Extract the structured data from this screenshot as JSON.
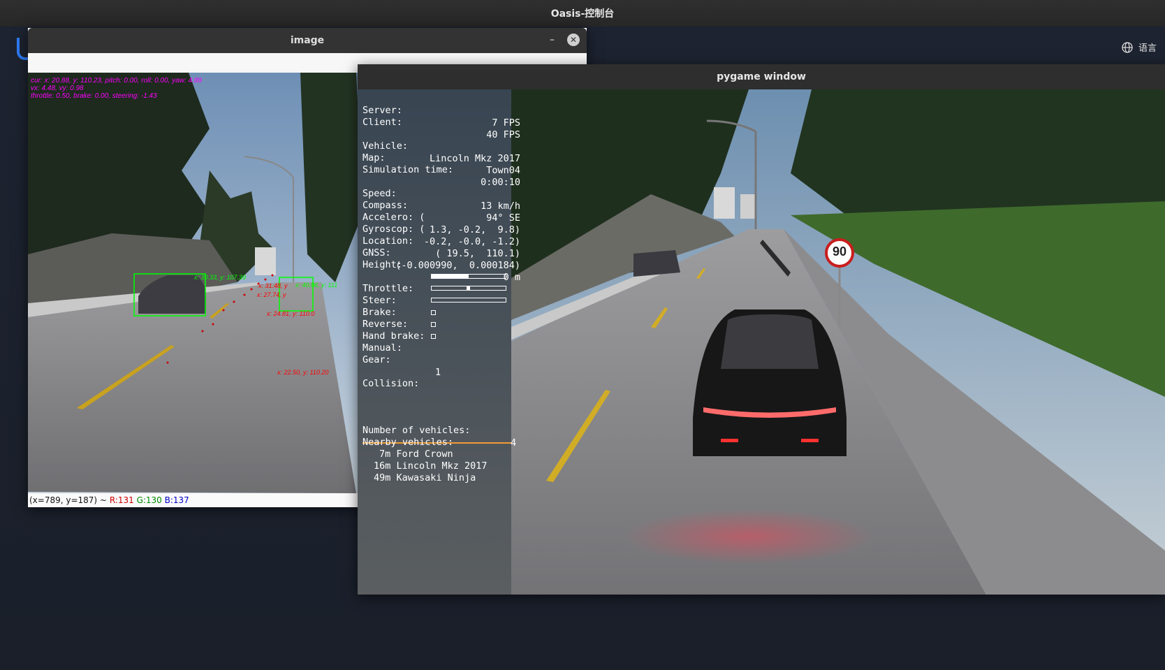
{
  "app": {
    "title": "Oasis-控制台",
    "language_label": "语言"
  },
  "image_window": {
    "title": "image",
    "overlay": [
      "cur: x: 20.88, y: 110.23, pitch: 0.00, roll: 0.00, yaw: 4.89",
      "vx: 4.48, vy: 0.98",
      "throttle: 0.50, brake: 0.00, steering: -1.43"
    ],
    "detections": {
      "green": [
        "x: 30.33, y: 107.39",
        "x: 40.06, y: 111"
      ],
      "red": [
        "x: 31.48, y",
        "x: 27.74, y",
        "x: 24.81, y: 110.0",
        "x: 22.50, y: 110.20"
      ]
    },
    "status": {
      "prefix": "(x=789, y=187) ~",
      "r": "R:131",
      "g": "G:130",
      "b": "B:137"
    }
  },
  "pygame_window": {
    "title": "pygame window",
    "hud": {
      "server": {
        "label": "Server:",
        "value": "7 FPS"
      },
      "client": {
        "label": "Client:",
        "value": "40 FPS"
      },
      "vehicle": {
        "label": "Vehicle:",
        "value": "Lincoln Mkz 2017"
      },
      "map": {
        "label": "Map:",
        "value": "Town04"
      },
      "sim_time": {
        "label": "Simulation time:",
        "value": "0:00:10"
      },
      "speed": {
        "label": "Speed:",
        "value": "13 km/h"
      },
      "compass": {
        "label": "Compass:",
        "value": "94° SE"
      },
      "accelero": {
        "label": "Accelero: (",
        "value": "1.3, -0.2,  9.8)"
      },
      "gyroscop": {
        "label": "Gyroscop: (",
        "value": "-0.2, -0.0, -1.2)"
      },
      "location": {
        "label": "Location:",
        "value": "( 19.5,  110.1)"
      },
      "gnss": {
        "label": "GNSS:",
        "value": "(-0.000990,  0.000184)"
      },
      "height": {
        "label": "Height:",
        "value": "0 m"
      },
      "throttle": {
        "label": "Throttle:",
        "fraction": 0.5
      },
      "steer": {
        "label": "Steer:",
        "fraction": 0.5
      },
      "brake": {
        "label": "Brake:",
        "fraction": 0.0
      },
      "reverse": {
        "label": "Reverse:"
      },
      "hand_brake": {
        "label": "Hand brake:"
      },
      "manual": {
        "label": "Manual:"
      },
      "gear": {
        "label": "Gear:",
        "value": "1"
      },
      "collision": {
        "label": "Collision:"
      },
      "num_vehicles": {
        "label": "Number of vehicles:",
        "value": "4"
      },
      "nearby_label": "Nearby vehicles:",
      "nearby": [
        "7m Ford Crown",
        "16m Lincoln Mkz 2017",
        "49m Kawasaki Ninja"
      ]
    },
    "speed_sign": "90"
  }
}
